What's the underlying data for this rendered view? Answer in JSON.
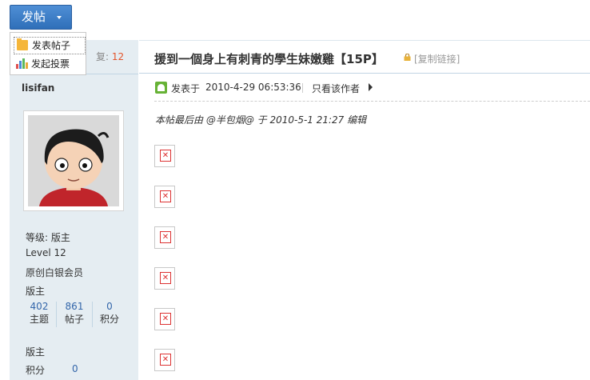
{
  "post_button": {
    "label": "发帖"
  },
  "dropdown": {
    "items": [
      {
        "label": "发表帖子",
        "icon": "folder-icon"
      },
      {
        "label": "发起投票",
        "icon": "bar-chart-icon"
      }
    ]
  },
  "thread": {
    "replies_label": "复:",
    "replies_value": "12",
    "title": "援到一個身上有刺青的學生妹嫩雞【15P】",
    "copy_link": "[复制链接]"
  },
  "author": {
    "name": "lisifan",
    "group_label": "等级: 版主",
    "level": "Level 12",
    "title": "原创白银会员",
    "role": "版主",
    "stats": [
      {
        "value": "402",
        "label": "主题"
      },
      {
        "value": "861",
        "label": "帖子"
      },
      {
        "value": "0",
        "label": "积分"
      }
    ],
    "role2": "版主",
    "points_label": "积分",
    "points_value": "0"
  },
  "post": {
    "posted_prefix": "发表于",
    "posted_time": "2010-4-29 06:53:36",
    "only_author": "只看该作者",
    "edit_note": "本帖最后由 @半包烟@ 于 2010-5-1 21:27 编辑",
    "broken_images": 6
  },
  "colors": {
    "accent": "#2f6fb9",
    "sidebar_bg": "#e5edf2",
    "reply_count": "#e4542a",
    "stat_number": "#3366aa"
  }
}
